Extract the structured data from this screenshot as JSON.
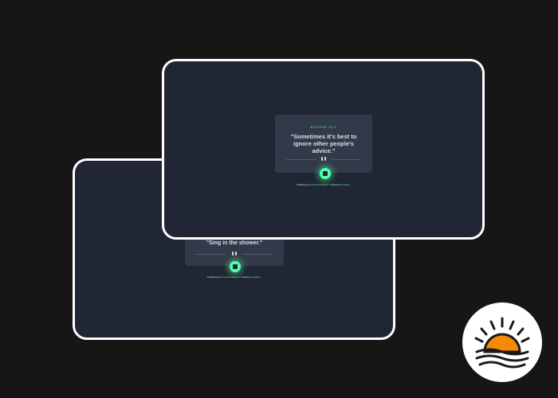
{
  "back_window": {
    "quote": "\"Sing in the shower.\"",
    "attribution": {
      "prefix": "Challenge by ",
      "challenge_link": "Frontend Mentor",
      "middle": ". Coded by ",
      "author_link": "Lumiano"
    }
  },
  "front_window": {
    "advice_id": "ADVICE #17",
    "quote": "\"Sometimes it's best to ignore other people's advice.\"",
    "attribution": {
      "prefix": "Challenge by ",
      "challenge_link": "Frontend Mentor",
      "middle": ". Coded by ",
      "author_link": "Lumiano"
    }
  },
  "colors": {
    "page_bg": "#161616",
    "window_bg": "#202633",
    "card_bg": "#323a49",
    "accent": "#53ffab",
    "sun": "#f58a07"
  },
  "icons": {
    "dice": "dice-icon",
    "divider_pause": "pause-icon",
    "logo": "sunset-logo-icon"
  }
}
